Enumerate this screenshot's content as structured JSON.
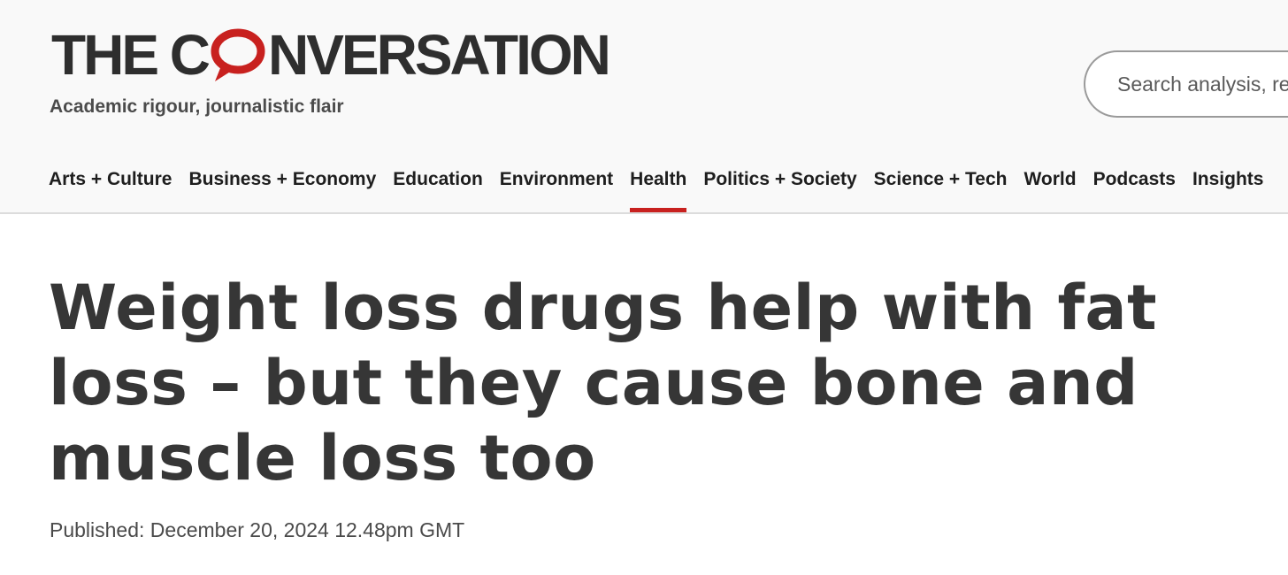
{
  "brand": {
    "logo_left": "THE C",
    "logo_right": "NVERSATION",
    "tagline": "Academic rigour, journalistic flair",
    "accent_color": "#c8211f"
  },
  "search": {
    "placeholder": "Search analysis, research, academics…"
  },
  "nav": {
    "items": [
      {
        "label": "Arts + Culture"
      },
      {
        "label": "Business + Economy"
      },
      {
        "label": "Education"
      },
      {
        "label": "Environment"
      },
      {
        "label": "Health",
        "active": true
      },
      {
        "label": "Politics + Society"
      },
      {
        "label": "Science + Tech"
      },
      {
        "label": "World"
      },
      {
        "label": "Podcasts"
      },
      {
        "label": "Insights"
      }
    ]
  },
  "article": {
    "headline": "Weight loss drugs help with fat loss – but they cause bone and muscle loss too",
    "published": "Published: December 20, 2024 12.48pm GMT"
  }
}
